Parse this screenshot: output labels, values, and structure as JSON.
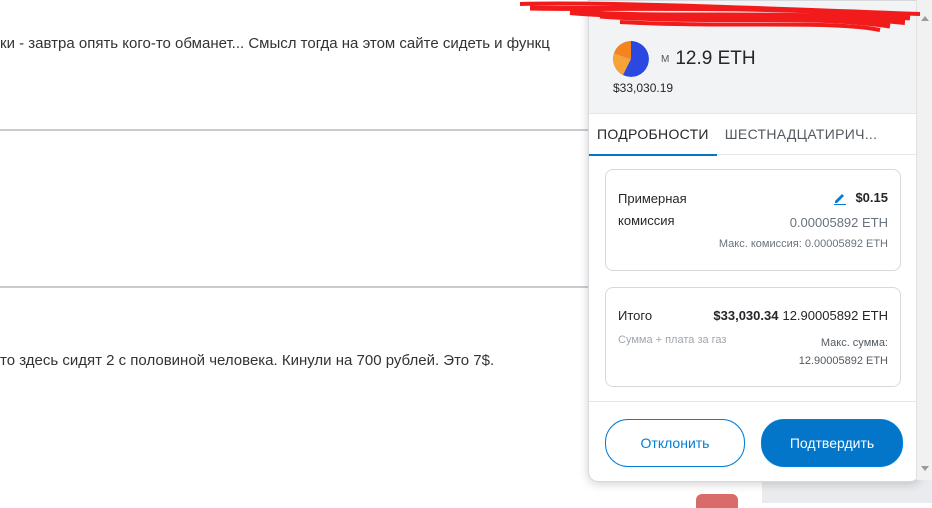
{
  "background": {
    "line1": "ки - завтра опять кого-то обманет... Смысл тогда на этом сайте сидеть и функц",
    "line2": "то здесь сидят 2 с половиной человека. Кинули на 700 рублей. Это 7$."
  },
  "wallet": {
    "token_letter": "M",
    "balance": "12.9 ETH",
    "balance_usd": "$33,030.19",
    "tabs": [
      {
        "label": "ПОДРОБНОСТИ"
      },
      {
        "label": "ШЕСТНАДЦАТИРИЧ..."
      }
    ],
    "fee": {
      "label": "Примерная комиссия",
      "usd": "$0.15",
      "eth": "0.00005892 ETH",
      "max": "Макс. комиссия: 0.00005892 ETH"
    },
    "total": {
      "label": "Итого",
      "usd": "$33,030.34",
      "eth": "12.90005892 ETH",
      "sub": "Сумма + плата за газ",
      "max_label": "Макс. сумма:",
      "max_value": "12.90005892 ETH"
    },
    "buttons": {
      "reject": "Отклонить",
      "confirm": "Подтвердить"
    },
    "colors": {
      "accent": "#0376c9",
      "identicon_a": "#f5841f",
      "identicon_b": "#2b49e0"
    }
  }
}
